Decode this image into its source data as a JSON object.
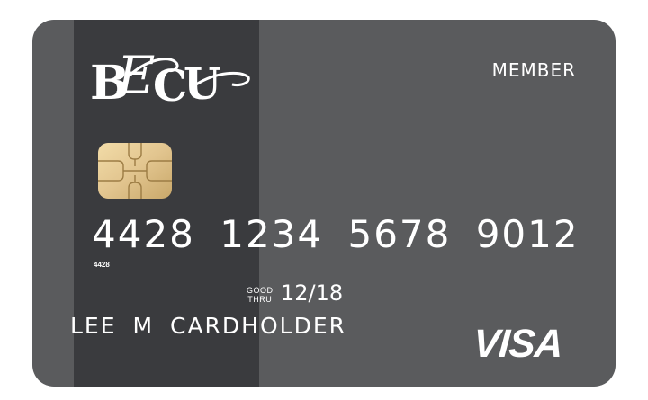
{
  "card": {
    "logo_text": "BECU",
    "membership_label": "MEMBER",
    "card_number": "4428 1234 5678 9012",
    "card_number_prefix": "4428",
    "good_thru_top": "GOOD",
    "good_thru_bottom": "THRU",
    "expiry": "12/18",
    "cardholder_name": "LEE M CARDHOLDER",
    "network": "VISA"
  },
  "colors": {
    "card_body": "#5a5b5d",
    "card_stripe": "#3a3b3e",
    "chip_gold": "#e2c58f",
    "text": "#ffffff"
  },
  "icons": {
    "chip": "emv-chip-icon",
    "logo": "becu-logo"
  }
}
